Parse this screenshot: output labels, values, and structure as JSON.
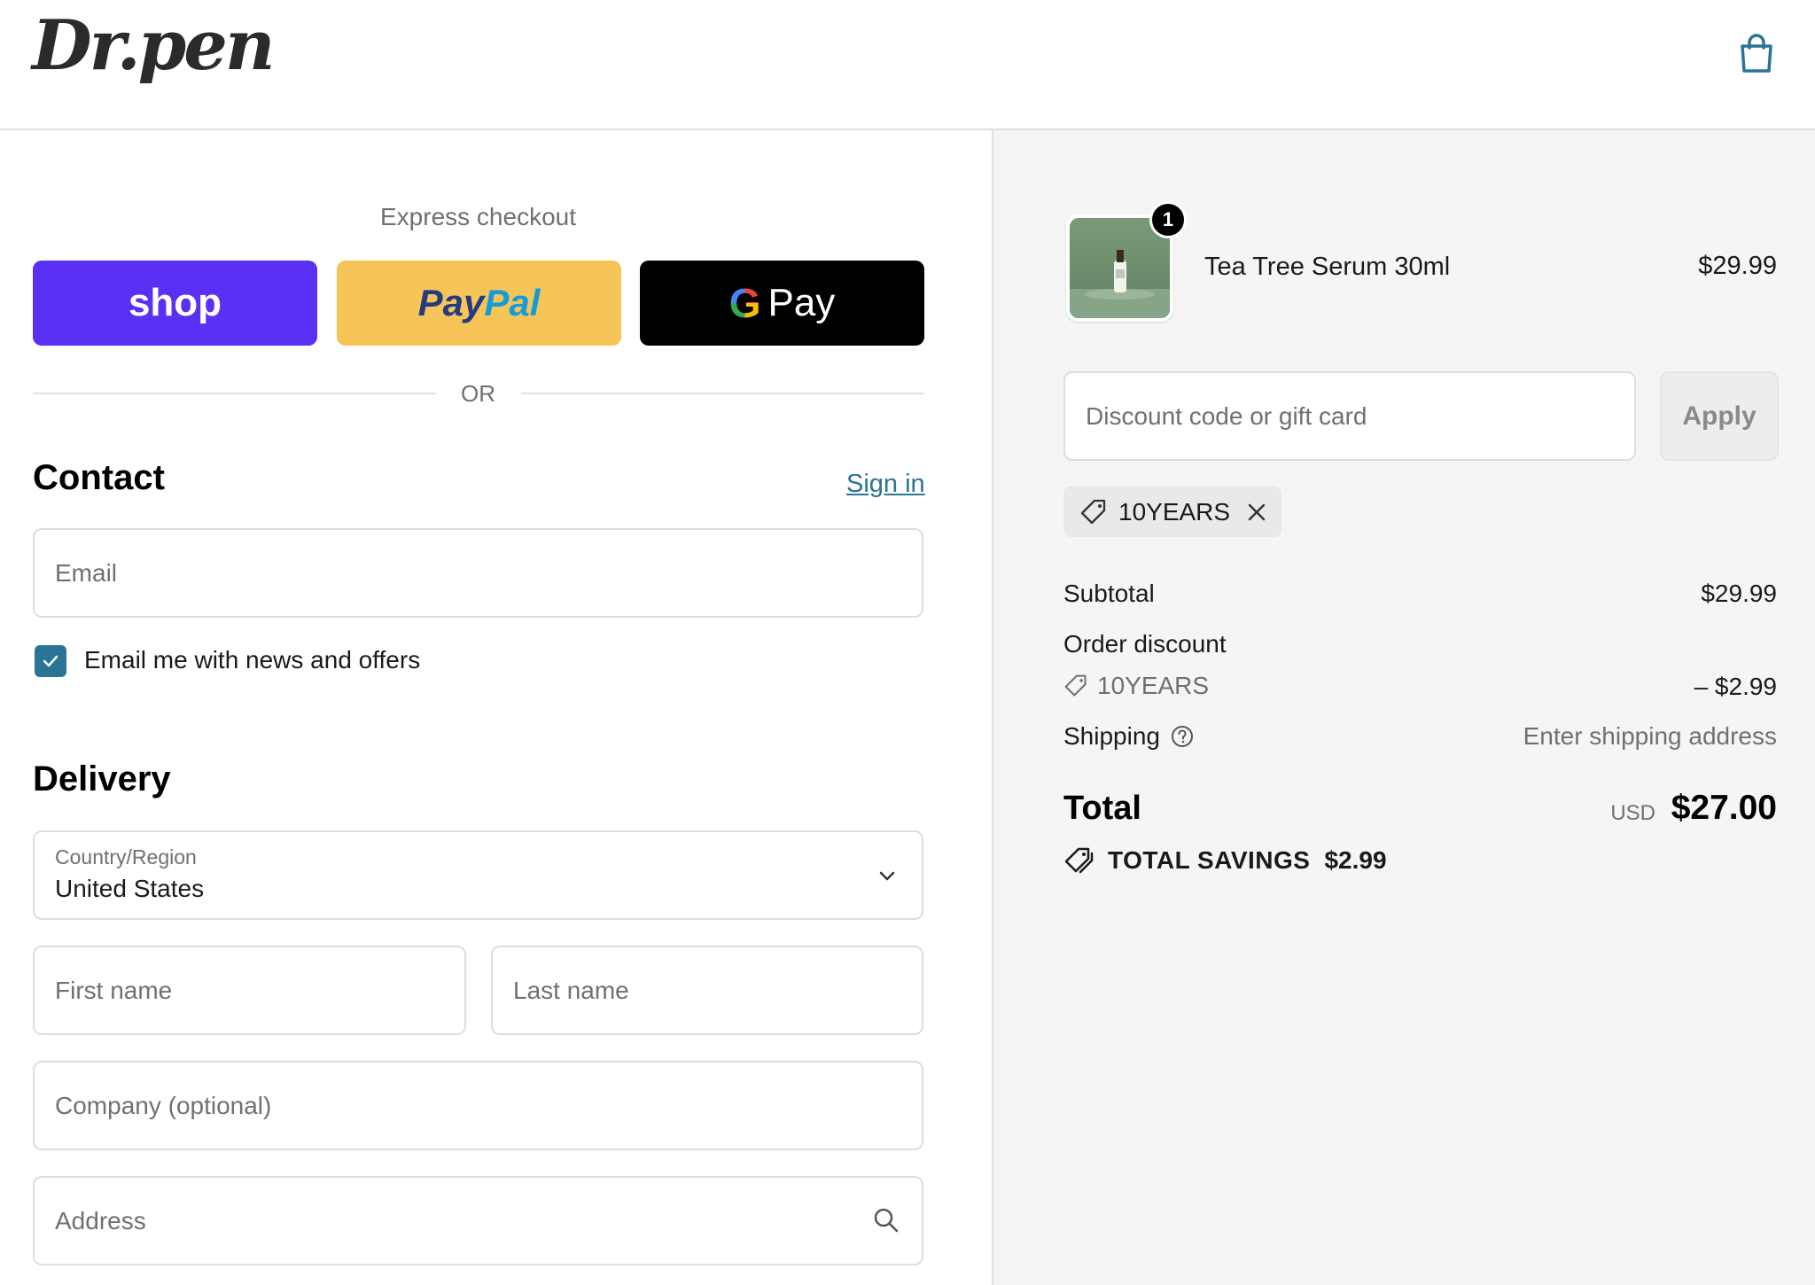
{
  "header": {
    "logo_text": "Dr.pen",
    "cart_icon": "shopping-bag-icon"
  },
  "express": {
    "label": "Express checkout",
    "shop_label": "shop",
    "paypal_label_1": "Pay",
    "paypal_label_2": "Pal",
    "gpay_g": "G",
    "gpay_label": "Pay",
    "or_text": "OR"
  },
  "contact": {
    "title": "Contact",
    "sign_in": "Sign in",
    "email_placeholder": "Email",
    "newsletter_label": "Email me with news and offers",
    "newsletter_checked": true
  },
  "delivery": {
    "title": "Delivery",
    "country_label": "Country/Region",
    "country_value": "United States",
    "first_name_placeholder": "First name",
    "last_name_placeholder": "Last name",
    "company_placeholder": "Company (optional)",
    "address_placeholder": "Address"
  },
  "summary": {
    "item": {
      "quantity": "1",
      "name": "Tea Tree Serum 30ml",
      "price": "$29.99"
    },
    "discount_placeholder": "Discount code or gift card",
    "apply_label": "Apply",
    "applied_code": "10YEARS",
    "subtotal_label": "Subtotal",
    "subtotal_value": "$29.99",
    "order_discount_label": "Order discount",
    "discount_code": "10YEARS",
    "discount_value": "– $2.99",
    "shipping_label": "Shipping",
    "shipping_value": "Enter shipping address",
    "total_label": "Total",
    "total_currency": "USD",
    "total_value": "$27.00",
    "savings_label": "TOTAL SAVINGS",
    "savings_value": "$2.99"
  },
  "colors": {
    "shop_purple": "#5a31f4",
    "paypal_yellow": "#f7c557",
    "accent_teal": "#2a7495",
    "summary_bg": "#f5f5f5"
  }
}
